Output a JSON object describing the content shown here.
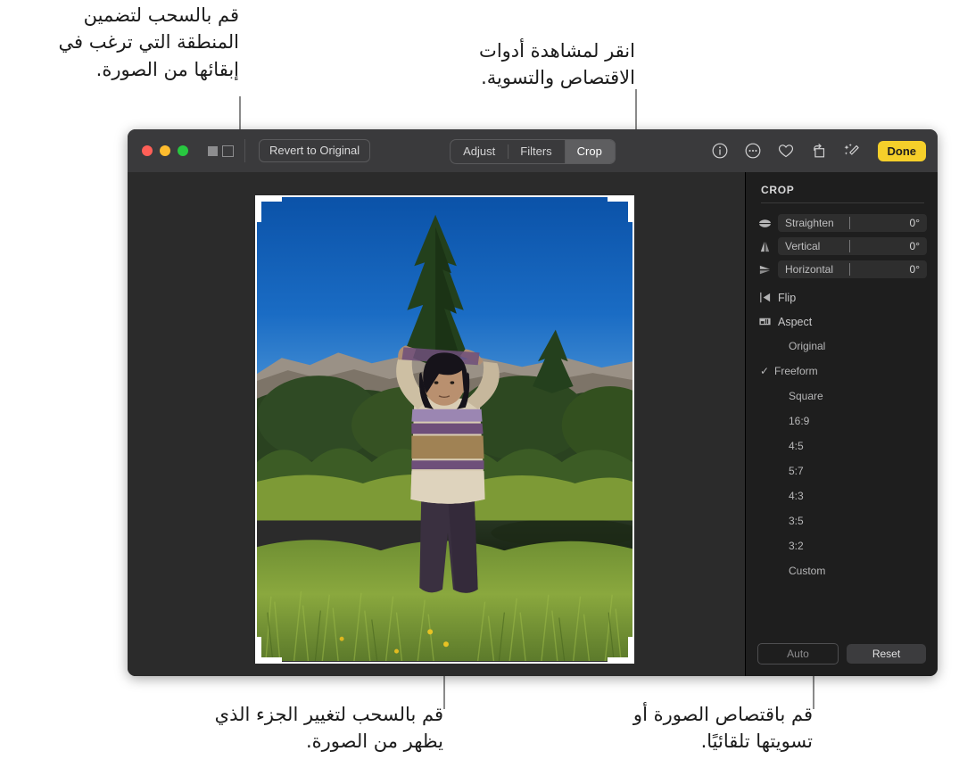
{
  "callouts": [
    {
      "id": "crop-drag-region",
      "text": "قم بالسحب لتضمين\nالمنطقة التي ترغب في\nإبقائها من الصورة."
    },
    {
      "id": "crop-tools-click",
      "text": "انقر لمشاهدة أدوات\nالاقتصاص والتسوية."
    },
    {
      "id": "drag-visible-part",
      "text": "قم بالسحب لتغيير الجزء الذي\nيظهر من الصورة."
    },
    {
      "id": "auto-crop-straighten",
      "text": "قم باقتصاص الصورة أو\nتسويتها تلقائيًا."
    }
  ],
  "window": {
    "titlebar": {
      "revert_label": "Revert to Original",
      "segments": [
        {
          "label": "Adjust",
          "active": false
        },
        {
          "label": "Filters",
          "active": false
        },
        {
          "label": "Crop",
          "active": true
        }
      ],
      "tools": [
        {
          "name": "info-icon"
        },
        {
          "name": "more-options-icon"
        },
        {
          "name": "heart-icon"
        },
        {
          "name": "rotate-icon"
        },
        {
          "name": "magic-wand-icon"
        }
      ],
      "done_label": "Done"
    },
    "inspector": {
      "title": "CROP",
      "sliders": [
        {
          "icon": "straighten-icon",
          "label": "Straighten",
          "value": "0°"
        },
        {
          "icon": "vertical-icon",
          "label": "Vertical",
          "value": "0°"
        },
        {
          "icon": "horizontal-icon",
          "label": "Horizontal",
          "value": "0°"
        }
      ],
      "menu": [
        {
          "icon": "flip-icon",
          "label": "Flip"
        },
        {
          "icon": "aspect-icon",
          "label": "Aspect"
        }
      ],
      "aspects": [
        {
          "label": "Original",
          "checked": false
        },
        {
          "label": "Freeform",
          "checked": true
        },
        {
          "label": "Square",
          "checked": false
        },
        {
          "label": "16:9",
          "checked": false
        },
        {
          "label": "4:5",
          "checked": false
        },
        {
          "label": "5:7",
          "checked": false
        },
        {
          "label": "4:3",
          "checked": false
        },
        {
          "label": "3:5",
          "checked": false
        },
        {
          "label": "3:2",
          "checked": false
        },
        {
          "label": "Custom",
          "checked": false
        }
      ],
      "check_glyph": "✓",
      "footer": {
        "auto_label": "Auto",
        "reset_label": "Reset"
      }
    }
  },
  "colors": {
    "accent": "#f5cf2a",
    "titlebar": "#3a3a3c",
    "panel": "#1e1e1e",
    "canvas": "#2b2b2b",
    "crop_border": "#ffffff"
  }
}
